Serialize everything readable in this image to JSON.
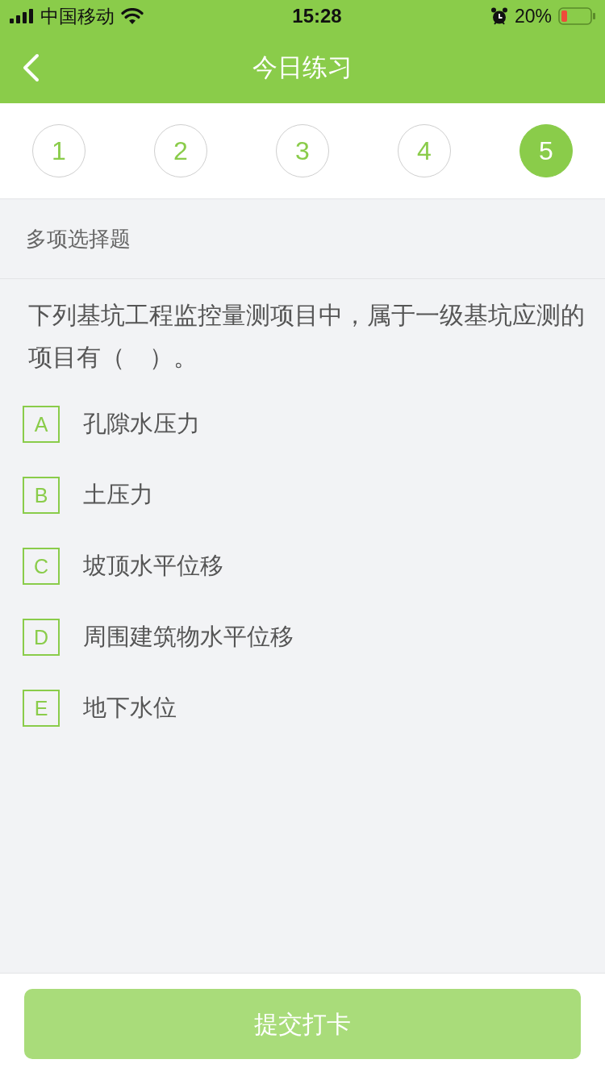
{
  "status_bar": {
    "carrier": "中国移动",
    "time": "15:28",
    "battery": "20%"
  },
  "nav_bar": {
    "title": "今日练习"
  },
  "steps": [
    {
      "label": "1",
      "selected": false
    },
    {
      "label": "2",
      "selected": false
    },
    {
      "label": "3",
      "selected": false
    },
    {
      "label": "4",
      "selected": false
    },
    {
      "label": "5",
      "selected": true
    }
  ],
  "question": {
    "type_label": "多项选择题",
    "text": "下列基坑工程监控量测项目中，属于一级基坑应测的项目有（　）。",
    "options": [
      {
        "letter": "A",
        "text": "孔隙水压力",
        "selected": false
      },
      {
        "letter": "B",
        "text": "土压力",
        "selected": false
      },
      {
        "letter": "C",
        "text": "坡顶水平位移",
        "selected": false
      },
      {
        "letter": "D",
        "text": "周围建筑物水平位移",
        "selected": false
      },
      {
        "letter": "E",
        "text": "地下水位",
        "selected": false
      }
    ]
  },
  "submit_button": {
    "label": "提交打卡",
    "disabled": true
  }
}
